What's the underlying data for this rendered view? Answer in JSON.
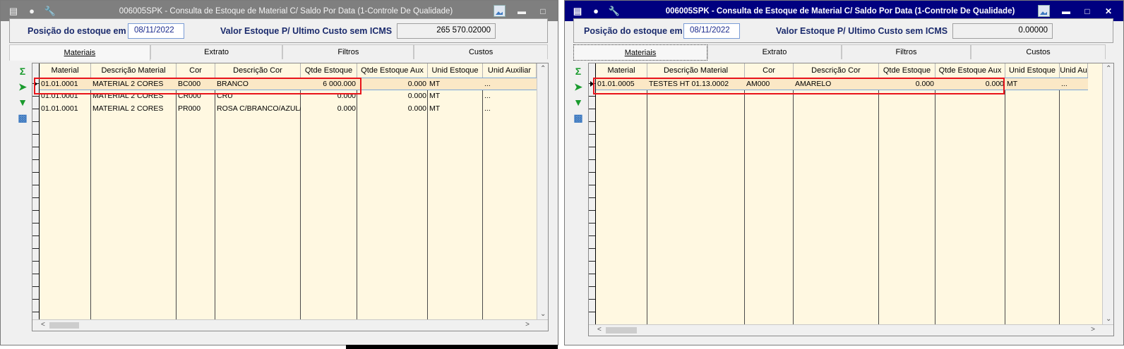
{
  "windows": [
    {
      "title": "006005SPK - Consulta de Estoque de Material C/ Saldo Por Data (1-Controle De Qualidade)",
      "active": false,
      "position_label": "Posição do estoque em",
      "position_date": "08/11/2022",
      "valor_label": "Valor Estoque P/ Ultimo Custo sem ICMS",
      "valor_value": "265 570.02000",
      "tabs": [
        "Materiais",
        "Extrato",
        "Filtros",
        "Custos"
      ],
      "columns": [
        "Material",
        "Descrição Material",
        "Cor",
        "Descrição Cor",
        "Qtde Estoque",
        "Qtde Estoque Aux",
        "Unid Estoque",
        "Unid Auxiliar"
      ],
      "rows": [
        {
          "material": "01.01.0001",
          "descricao": "MATERIAL 2 CORES",
          "cor": "BC000",
          "desc_cor": "BRANCO",
          "qtde": "6 000.000",
          "qtde_aux": "0.000",
          "unid": "MT",
          "unid_aux": "..."
        },
        {
          "material": "01.01.0001",
          "descricao": "MATERIAL 2 CORES",
          "cor": "CR000",
          "desc_cor": "CRU",
          "qtde": "0.000",
          "qtde_aux": "0.000",
          "unid": "MT",
          "unid_aux": "..."
        },
        {
          "material": "01.01.0001",
          "descricao": "MATERIAL 2 CORES",
          "cor": "PR000",
          "desc_cor": "ROSA C/BRANCO/AZUL/E",
          "qtde": "0.000",
          "qtde_aux": "0.000",
          "unid": "MT",
          "unid_aux": "..."
        }
      ]
    },
    {
      "title": "006005SPK - Consulta de Estoque de Material C/ Saldo Por Data (1-Controle De Qualidade)",
      "active": true,
      "position_label": "Posição do estoque em",
      "position_date": "08/11/2022",
      "valor_label": "Valor Estoque P/ Ultimo Custo sem ICMS",
      "valor_value": "0.00000",
      "tabs": [
        "Materiais",
        "Extrato",
        "Filtros",
        "Custos"
      ],
      "columns": [
        "Material",
        "Descrição Material",
        "Cor",
        "Descrição Cor",
        "Qtde Estoque",
        "Qtde Estoque Aux",
        "Unid Estoque",
        "Unid Au"
      ],
      "rows": [
        {
          "material": "01.01.0005",
          "descricao": "TESTES HT 01.13.0002",
          "cor": "AM000",
          "desc_cor": "AMARELO",
          "qtde": "0.000",
          "qtde_aux": "0.000",
          "unid": "MT",
          "unid_aux": "..."
        }
      ]
    }
  ],
  "colors": {
    "highlight": "#e8141b",
    "grid_bg": "#fff8e1",
    "active_title": "#000080",
    "inactive_title": "#7f7f7f"
  }
}
